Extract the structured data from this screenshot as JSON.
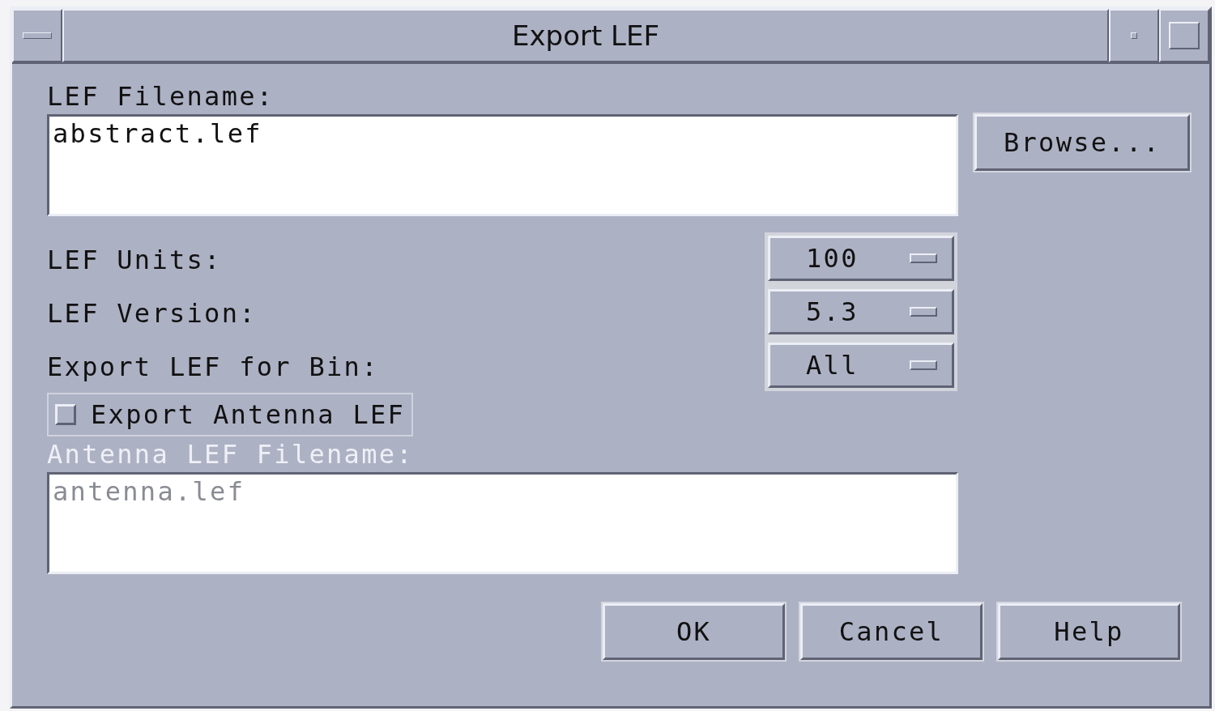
{
  "window": {
    "title": "Export LEF"
  },
  "lef_filename": {
    "label": "LEF Filename:",
    "value": "abstract.lef"
  },
  "browse_button": "Browse...",
  "options": [
    {
      "label": "LEF Units:",
      "value": "100"
    },
    {
      "label": "LEF Version:",
      "value": "5.3"
    },
    {
      "label": "Export LEF for Bin:",
      "value": "All"
    }
  ],
  "export_antenna": {
    "label": "Export Antenna LEF",
    "checked": false
  },
  "antenna_filename": {
    "label": "Antenna LEF Filename:",
    "value": "antenna.lef",
    "disabled": true
  },
  "buttons": [
    "OK",
    "Cancel",
    "Help"
  ]
}
